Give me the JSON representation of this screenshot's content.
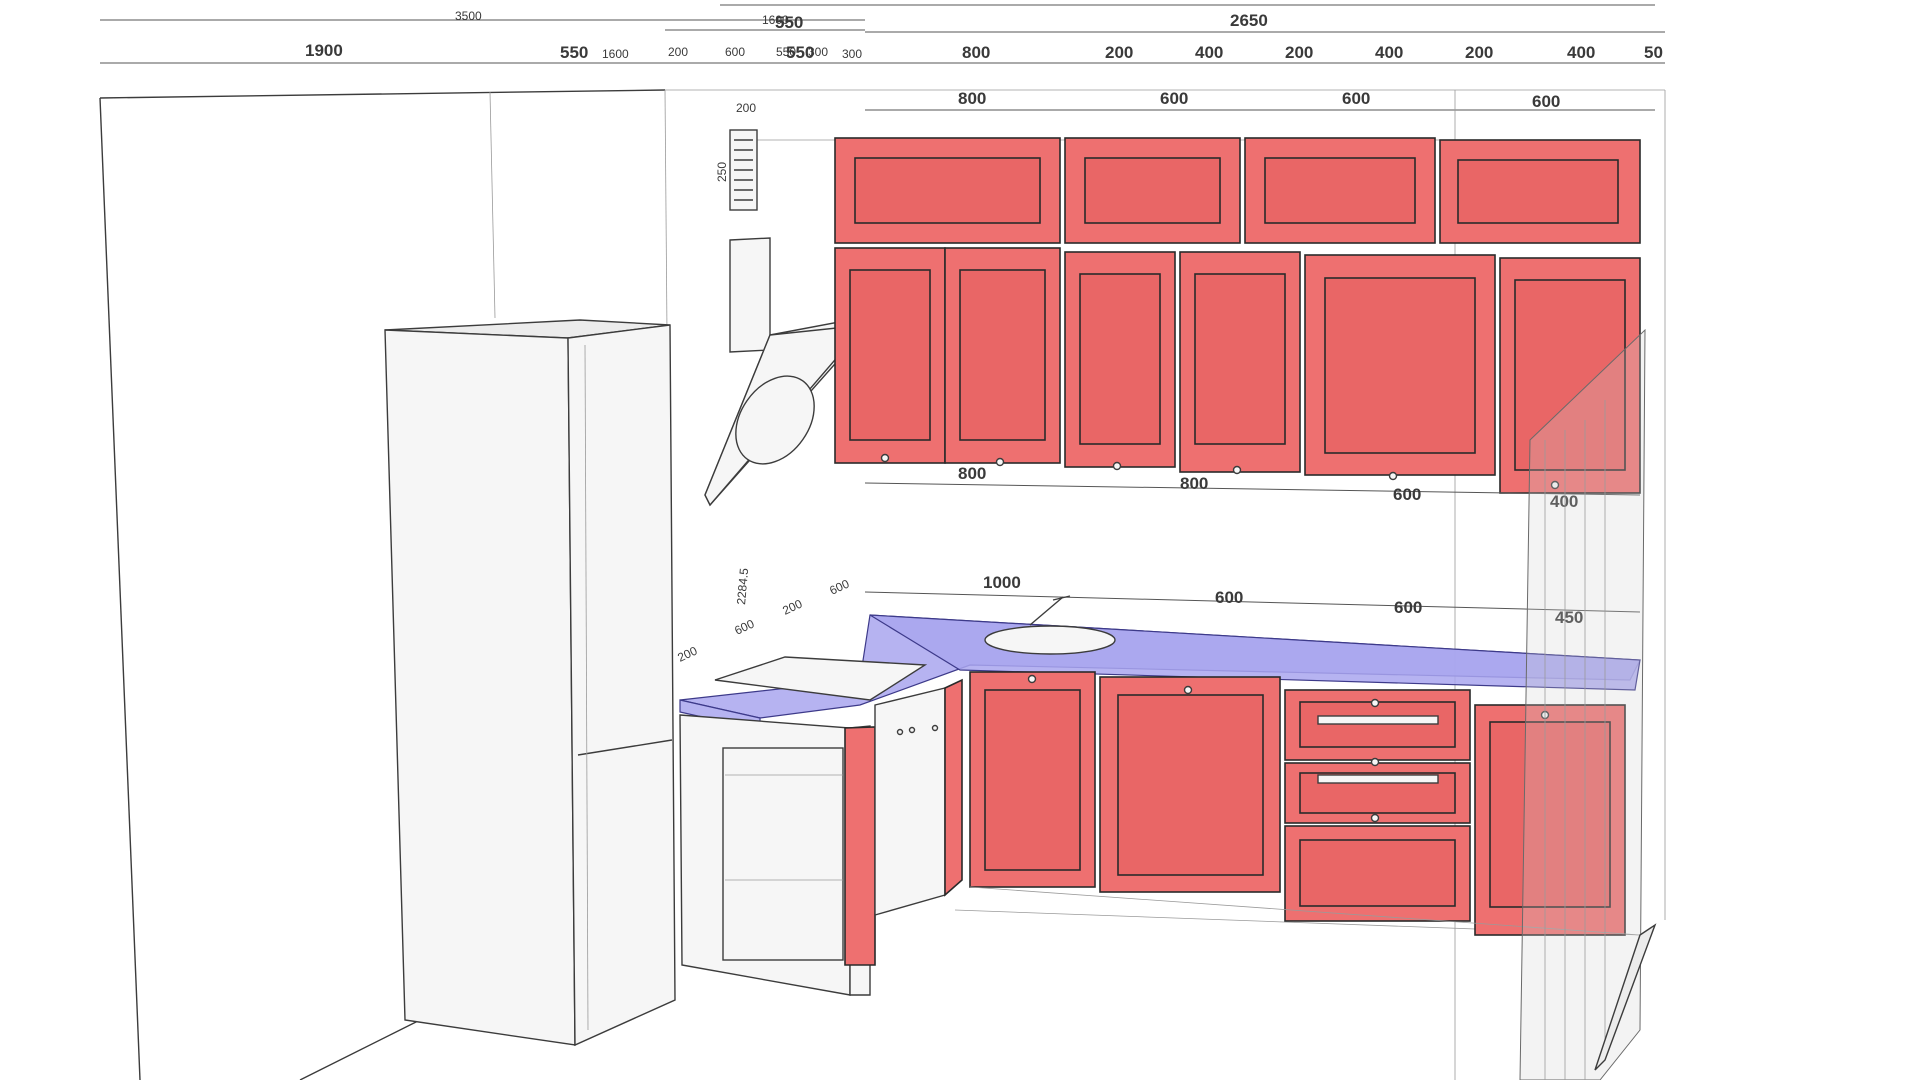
{
  "dimensions": {
    "top_row_1": [
      "3500",
      "1600",
      "550",
      "2650"
    ],
    "top_row_2": [
      "1900",
      "550",
      "1600",
      "200",
      "600",
      "550",
      "550",
      "300",
      "300",
      "800",
      "200",
      "400",
      "200",
      "400",
      "200",
      "400",
      "50"
    ],
    "upper_cabinets": [
      "800",
      "600",
      "600",
      "600"
    ],
    "upper_bottom": [
      "800",
      "800",
      "600",
      "400"
    ],
    "counter": [
      "1000",
      "600",
      "600",
      "450"
    ],
    "vent": [
      "200",
      "250"
    ],
    "left_vertical": [
      "2284.5",
      "200",
      "600",
      "600",
      "200"
    ]
  }
}
